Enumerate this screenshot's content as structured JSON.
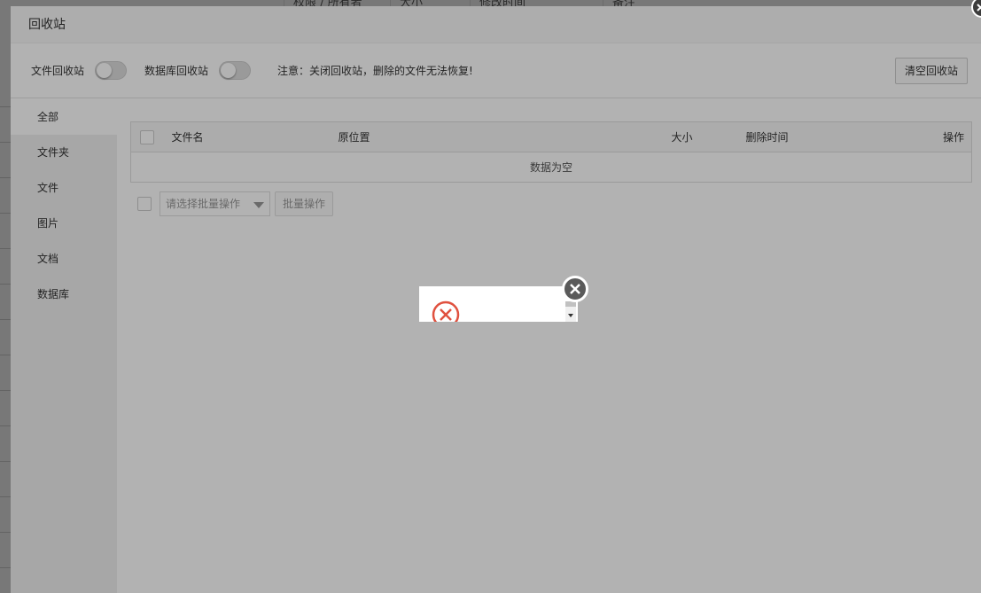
{
  "background": {
    "headers": [
      "权限 / 所有者",
      "大小",
      "修改时间",
      "备注"
    ]
  },
  "window": {
    "title": "回收站"
  },
  "toolbar": {
    "file_recycle_label": "文件回收站",
    "db_recycle_label": "数据库回收站",
    "notice": "注意：关闭回收站，删除的文件无法恢复!",
    "clear_button": "清空回收站"
  },
  "sidebar": {
    "items": [
      {
        "label": "全部",
        "active": true
      },
      {
        "label": "文件夹"
      },
      {
        "label": "文件"
      },
      {
        "label": "图片"
      },
      {
        "label": "文档"
      },
      {
        "label": "数据库"
      }
    ]
  },
  "table": {
    "columns": [
      "文件名",
      "原位置",
      "大小",
      "删除时间",
      "操作"
    ],
    "empty_text": "数据为空"
  },
  "batch": {
    "select_placeholder": "请选择批量操作",
    "button": "批量操作"
  },
  "colors": {
    "error_icon": "#e0513f",
    "close_button": "#5a5a5a"
  },
  "icons": {
    "popup_close": "close-icon",
    "error": "error-circle-x-icon"
  }
}
